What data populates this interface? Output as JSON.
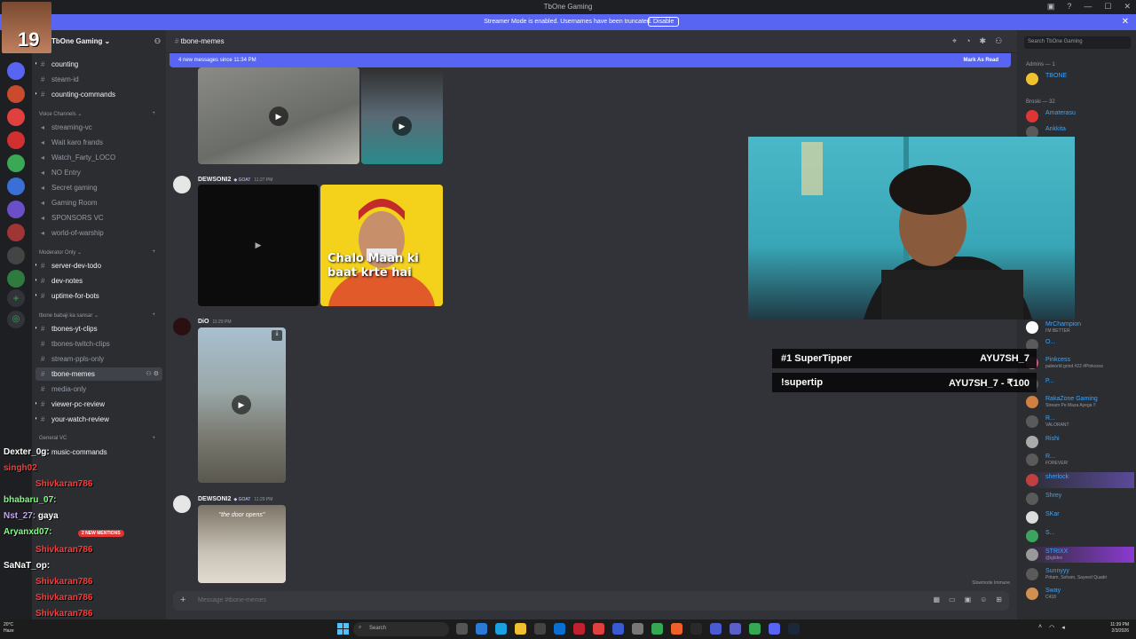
{
  "window": {
    "title": "TbOne Gaming"
  },
  "banner": {
    "text": "Streamer Mode is enabled. Usernames have been truncated.",
    "disable": "Disable"
  },
  "server": {
    "name": "TbOne Gaming ⌄"
  },
  "channels": {
    "top": [
      "counting",
      "steam-id",
      "counting-commands"
    ],
    "voice_label": "Voice Channels ⌄",
    "voice": [
      "streaming-vc",
      "Wait karo frands",
      "Watch_Farty_LOCO",
      "NO Entry",
      "Secret gaming",
      "Gaming Room",
      "SPONSORS VC",
      "world-of-warship"
    ],
    "mod_label": "Moderator Only ⌄",
    "mod": [
      "server-dev-todo",
      "dev-notes",
      "uptime-for-bots"
    ],
    "tb_label": "tbone babaji ka sansar ⌄",
    "tb": [
      "tbones-yt-clips",
      "tbones-twitch-clips",
      "stream-ppls-only",
      "tbone-memes",
      "media-only",
      "viewer-pc-review",
      "your-watch-review"
    ],
    "gen_label": "General VC",
    "gen": [
      "music-commands"
    ]
  },
  "chat": {
    "channel_name": "tbone-memes",
    "new_messages": "4 new messages since 11:34 PM",
    "mark_read": "Mark As Read",
    "messages": [
      {
        "author": "DEWSONI2",
        "tag": "GOAT",
        "time": "11:27 PM",
        "caption": "Chalo Maan ki baat krte hai"
      },
      {
        "author": "DiO",
        "tag": "",
        "time": "11:29 PM"
      },
      {
        "author": "DEWSONI2",
        "tag": "GOAT",
        "time": "11:29 PM",
        "caption": "\"the door opens\""
      }
    ],
    "composer_placeholder": "Message #tbone-memes",
    "slowmode": "Slowmode Immune"
  },
  "members": {
    "search_placeholder": "Search TbOne Gaming",
    "admin_label": "Admins — 1",
    "broski_label": "Broski — 32",
    "list": [
      {
        "name": "TBONE",
        "status": "",
        "color": "#3ba5ff"
      },
      {
        "name": "Amaterasu",
        "status": "",
        "color": "#3ba5ff"
      },
      {
        "name": "Ankkita",
        "status": "",
        "color": "#3ba5ff"
      },
      {
        "name": "MrChampion",
        "status": "I'M BETTER",
        "color": "#3ba5ff"
      },
      {
        "name": "O...",
        "status": "",
        "color": "#3ba5ff"
      },
      {
        "name": "Pinkcess",
        "status": "palworld grind #22 #Pinkcess",
        "color": "#3ba5ff"
      },
      {
        "name": "P...",
        "status": "",
        "color": "#3ba5ff"
      },
      {
        "name": "RakaZone Gaming",
        "status": "Stream Pe Maza Ayega !!",
        "color": "#3ba5ff"
      },
      {
        "name": "R...",
        "status": "VALORANT",
        "color": "#3ba5ff"
      },
      {
        "name": "Rishi",
        "status": "",
        "color": "#3ba5ff"
      },
      {
        "name": "R...",
        "status": "FOREVER!",
        "color": "#3ba5ff"
      },
      {
        "name": "sherlock",
        "status": "",
        "color": "#3ba5ff"
      },
      {
        "name": "Shrey",
        "status": "",
        "color": "#3ba5ff"
      },
      {
        "name": "SKar",
        "status": "",
        "color": "#3ba5ff"
      },
      {
        "name": "S...",
        "status": "",
        "color": "#3ba5ff"
      },
      {
        "name": "STRIXX",
        "status": "@iglidex",
        "color": "#3ba5ff"
      },
      {
        "name": "Sunnyyy",
        "status": "Pritam, Soham, Sayeed Quadri",
        "color": "#3ba5ff"
      },
      {
        "name": "Sway",
        "status": "C418",
        "color": "#3ba5ff"
      }
    ]
  },
  "stream_overlay": {
    "supertipper_label": "#1 SuperTipper",
    "supertipper_name": "AYU7SH_7",
    "supertip_label": "!supertip",
    "supertip_value": "AYU7SH_7 - ₹100",
    "corner_count": "19",
    "chat": [
      {
        "user": "Dexter_0g:",
        "color": "#ffffff"
      },
      {
        "user": "singh02",
        "color": "#ff3b3b"
      },
      {
        "user": "Shivkaran786",
        "color": "#ff3b3b"
      },
      {
        "user": "bhabaru_07:",
        "color": "#7fff7f"
      },
      {
        "user": "Nst_27:",
        "color": "#c8a0ff",
        "text": "gaya"
      },
      {
        "user": "Aryanxd07:",
        "color": "#7fff7f"
      },
      {
        "user": "Shivkaran786",
        "color": "#ff3b3b"
      },
      {
        "user": "SaNaT_op:",
        "color": "#ffffff"
      },
      {
        "user": "Shivkaran786",
        "color": "#ff3b3b"
      },
      {
        "user": "Shivkaran786",
        "color": "#ff3b3b"
      },
      {
        "user": "Shivkaran786",
        "color": "#ff3b3b"
      }
    ],
    "mentions": "2 NEW MENTIONS"
  },
  "taskbar": {
    "search": "Search",
    "weather_temp": "20°C",
    "weather_desc": "Haze",
    "time": "11:39 PM",
    "date": "2/3/2026"
  }
}
